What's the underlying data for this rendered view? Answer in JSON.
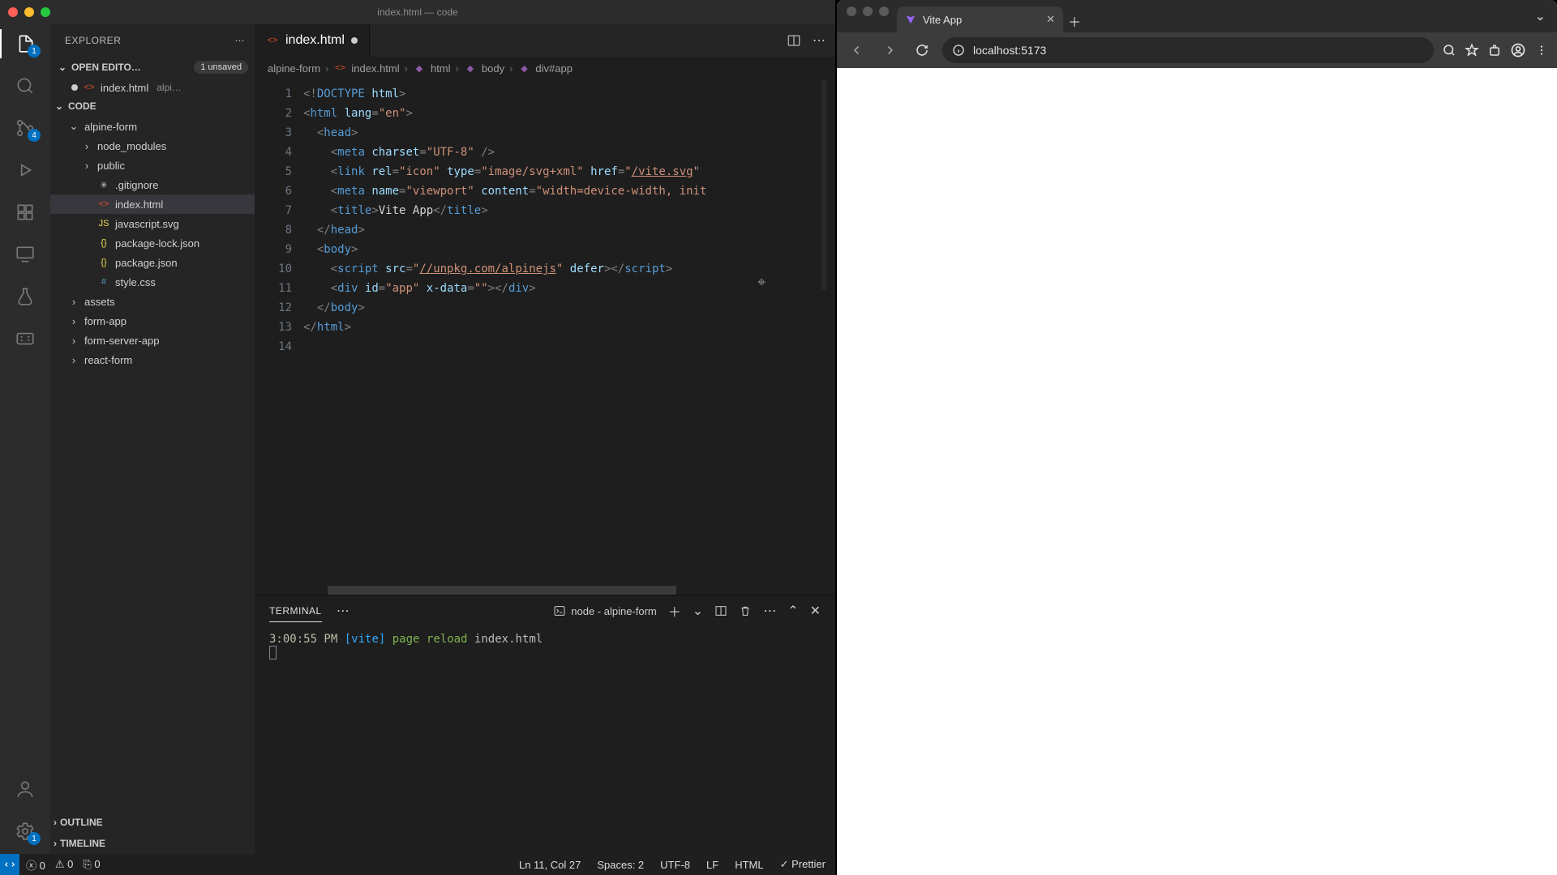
{
  "vscode": {
    "window_title": "index.html — code",
    "explorer": {
      "title": "EXPLORER",
      "open_editors_label": "OPEN EDITO…",
      "unsaved_badge": "1 unsaved",
      "open_file": {
        "name": "index.html",
        "hint": "alpi…"
      },
      "workspace_label": "CODE",
      "tree": {
        "folder": "alpine-form",
        "items": [
          {
            "name": "node_modules",
            "kind": "folder"
          },
          {
            "name": "public",
            "kind": "folder"
          },
          {
            "name": ".gitignore",
            "kind": "file"
          },
          {
            "name": "index.html",
            "kind": "html",
            "selected": true
          },
          {
            "name": "javascript.svg",
            "kind": "js"
          },
          {
            "name": "package-lock.json",
            "kind": "json"
          },
          {
            "name": "package.json",
            "kind": "json"
          },
          {
            "name": "style.css",
            "kind": "css"
          }
        ],
        "siblings": [
          {
            "name": "assets",
            "kind": "folder"
          },
          {
            "name": "form-app",
            "kind": "folder"
          },
          {
            "name": "form-server-app",
            "kind": "folder"
          },
          {
            "name": "react-form",
            "kind": "folder"
          }
        ]
      },
      "outline_label": "OUTLINE",
      "timeline_label": "TIMELINE"
    },
    "activity_badges": {
      "explorer": "1",
      "scm": "4",
      "settings": "1"
    },
    "tab": {
      "name": "index.html"
    },
    "breadcrumbs": [
      "alpine-form",
      "index.html",
      "html",
      "body",
      "div#app"
    ],
    "editor": {
      "lines": [
        "1",
        "2",
        "3",
        "4",
        "5",
        "6",
        "7",
        "8",
        "9",
        "10",
        "11",
        "12",
        "13",
        "14"
      ]
    },
    "terminal": {
      "tab_label": "TERMINAL",
      "process": "node - alpine-form",
      "line": {
        "ts": "3:00:55 PM",
        "tag": "[vite]",
        "msg1": "page",
        "msg2": "reload",
        "file": "index.html"
      }
    },
    "status": {
      "errors": "0",
      "warnings": "0",
      "ports": "0",
      "cursor": "Ln 11, Col 27",
      "spaces": "Spaces: 2",
      "enc": "UTF-8",
      "eol": "LF",
      "lang": "HTML",
      "prettier": "Prettier"
    }
  },
  "browser": {
    "tab_title": "Vite App",
    "url": "localhost:5173"
  }
}
